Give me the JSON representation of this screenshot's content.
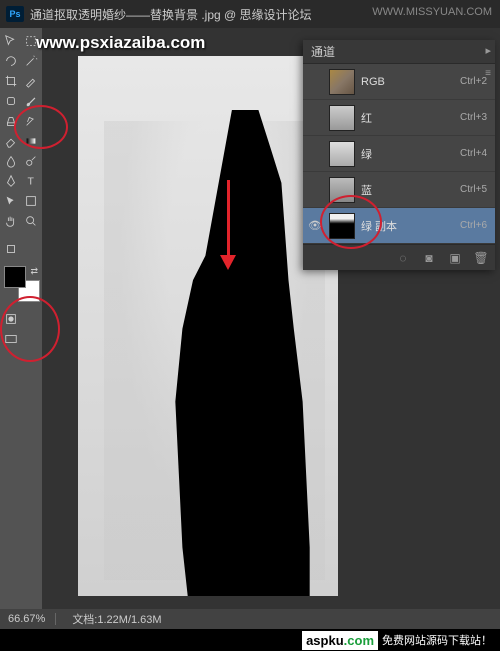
{
  "title_bar": {
    "ps_label": "Ps",
    "document_title": "通道抠取透明婚纱——替换背景 .jpg @ 思缘设计论坛"
  },
  "watermark": {
    "url": "www.psxiazaiba.com",
    "top_right": "WWW.MISSYUAN.COM"
  },
  "channels_panel": {
    "title": "通道",
    "items": [
      {
        "name": "RGB",
        "shortcut": "Ctrl+2",
        "visible": false
      },
      {
        "name": "红",
        "shortcut": "Ctrl+3",
        "visible": false
      },
      {
        "name": "绿",
        "shortcut": "Ctrl+4",
        "visible": false
      },
      {
        "name": "蓝",
        "shortcut": "Ctrl+5",
        "visible": false
      },
      {
        "name": "绿 副本",
        "shortcut": "Ctrl+6",
        "visible": true
      }
    ]
  },
  "status_bar": {
    "zoom": "66.67%",
    "doc_info": "文档:1.22M/1.63M"
  },
  "bottom_watermark": {
    "brand_prefix": "aspku",
    "brand_suffix": ".com",
    "text": "免费网站源码下载站！"
  },
  "tools": {
    "move": "move-tool",
    "marquee": "marquee-tool",
    "lasso": "lasso-tool",
    "wand": "magic-wand-tool",
    "crop": "crop-tool",
    "eyedropper": "eyedropper-tool",
    "healing": "healing-brush-tool",
    "brush": "brush-tool",
    "stamp": "clone-stamp-tool",
    "history": "history-brush-tool",
    "eraser": "eraser-tool",
    "gradient": "gradient-tool",
    "blur": "blur-tool",
    "dodge": "dodge-tool",
    "pen": "pen-tool",
    "type": "type-tool",
    "path": "path-selection-tool",
    "shape": "shape-tool",
    "hand": "hand-tool",
    "zoom": "zoom-tool"
  }
}
